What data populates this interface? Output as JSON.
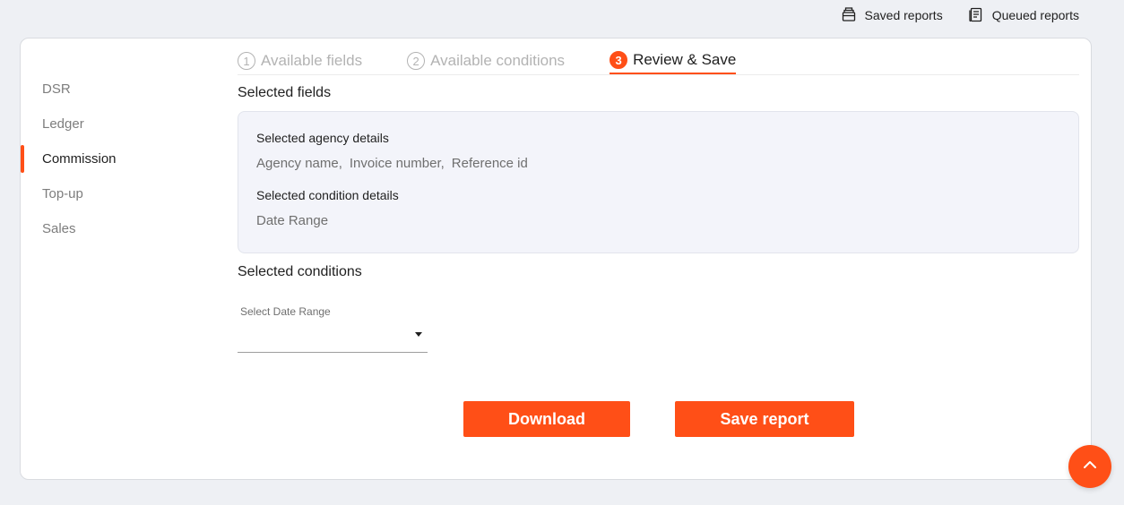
{
  "topbar": {
    "links": [
      {
        "label": "Saved reports",
        "icon": "saved-reports-icon"
      },
      {
        "label": "Queued reports",
        "icon": "queued-reports-icon"
      }
    ]
  },
  "sidebar": {
    "items": [
      {
        "label": "DSR",
        "active": false
      },
      {
        "label": "Ledger",
        "active": false
      },
      {
        "label": "Commission",
        "active": true
      },
      {
        "label": "Top-up",
        "active": false
      },
      {
        "label": "Sales",
        "active": false
      }
    ]
  },
  "steps": [
    {
      "num": "1",
      "label": "Available fields",
      "state": "inactive"
    },
    {
      "num": "2",
      "label": "Available conditions",
      "state": "inactive"
    },
    {
      "num": "3",
      "label": "Review & Save",
      "state": "active"
    }
  ],
  "review": {
    "selected_fields_title": "Selected fields",
    "agency_heading": "Selected agency details",
    "agency_values": [
      "Agency name,",
      "Invoice number,",
      "Reference id"
    ],
    "condition_heading": "Selected condition details",
    "condition_value": "Date Range",
    "selected_conditions_title": "Selected conditions",
    "date_range_label": "Select Date Range",
    "date_range_value": ""
  },
  "actions": {
    "download_label": "Download",
    "save_label": "Save report"
  },
  "colors": {
    "accent": "#ff4f17",
    "background": "#eef0f4",
    "summary_bg": "#f3f4fa"
  }
}
